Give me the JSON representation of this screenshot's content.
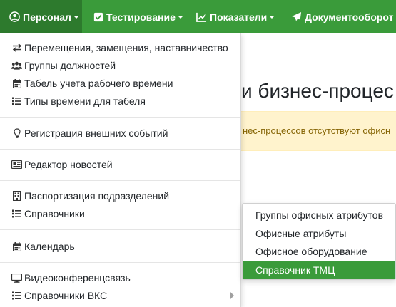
{
  "colors": {
    "navbar": "#3a9b3a",
    "navbar_active": "#2d7a2d",
    "highlight": "#3a9b3a",
    "alert_bg": "#fff3cd",
    "alert_text": "#856404"
  },
  "navbar": {
    "items": [
      {
        "label": "Персонал",
        "icon": "user-circle-icon",
        "active": true
      },
      {
        "label": "Тестирование",
        "icon": "checkbox-icon",
        "active": false
      },
      {
        "label": "Показатели",
        "icon": "line-chart-icon",
        "active": false
      },
      {
        "label": "Документооборот",
        "icon": "paper-plane-icon",
        "active": false
      }
    ]
  },
  "page": {
    "title_fragment": "и бизнес-процес",
    "alert_fragment": "нес-процессов отсутствуют офисн"
  },
  "dropdown": {
    "items": [
      {
        "label": "Перемещения, замещения, наставничество",
        "icon": "exchange-icon"
      },
      {
        "label": "Группы должностей",
        "icon": "users-icon"
      },
      {
        "label": "Табель учета рабочего времени",
        "icon": "calendar-icon"
      },
      {
        "label": "Типы времени для табеля",
        "icon": "list-icon"
      },
      {
        "label": "Регистрация внешних событий",
        "icon": "lightbulb-icon"
      },
      {
        "label": "Редактор новостей",
        "icon": "newspaper-icon"
      },
      {
        "label": "Паспортизация подразделений",
        "icon": "building-icon"
      },
      {
        "label": "Справочники",
        "icon": "list-icon"
      },
      {
        "label": "Календарь",
        "icon": "calendar-icon"
      },
      {
        "label": "Видеоконференцсвязь",
        "icon": "desktop-icon"
      },
      {
        "label": "Справочники ВКС",
        "icon": "list-icon"
      }
    ]
  },
  "submenu": {
    "items": [
      {
        "label": "Группы офисных атрибутов",
        "active": false
      },
      {
        "label": "Офисные атрибуты",
        "active": false
      },
      {
        "label": "Офисное оборудование",
        "active": false
      },
      {
        "label": "Справочник ТМЦ",
        "active": true
      }
    ]
  }
}
